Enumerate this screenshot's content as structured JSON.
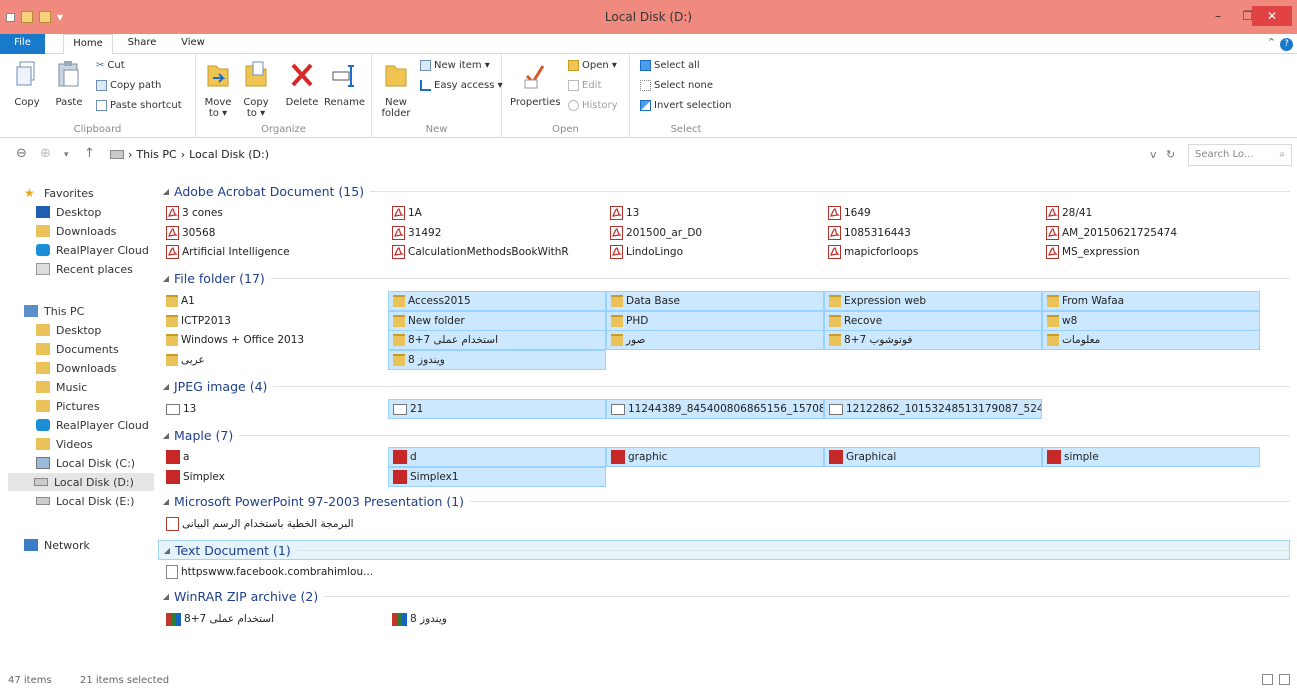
{
  "window": {
    "title": "Local Disk (D:)",
    "minimize": "–",
    "maximize": "❐",
    "close": "✕"
  },
  "tabs": {
    "file": "File",
    "home": "Home",
    "share": "Share",
    "view": "View"
  },
  "ribbon": {
    "clipboard": {
      "label": "Clipboard",
      "copy": "Copy",
      "paste": "Paste",
      "cut": "Cut",
      "copy_path": "Copy path",
      "paste_shortcut": "Paste shortcut"
    },
    "organize": {
      "label": "Organize",
      "move_to": "Move to ▾",
      "copy_to": "Copy to ▾",
      "delete": "Delete",
      "rename": "Rename"
    },
    "new": {
      "label": "New",
      "new_folder": "New folder",
      "new_item": "New item ▾",
      "easy_access": "Easy access ▾"
    },
    "open": {
      "label": "Open",
      "properties": "Properties",
      "open": "Open ▾",
      "edit": "Edit",
      "history": "History"
    },
    "select": {
      "label": "Select",
      "select_all": "Select all",
      "select_none": "Select none",
      "invert_selection": "Invert selection"
    }
  },
  "address": {
    "back": "⊖",
    "forward": "⊕",
    "recent": "▾",
    "up": "↑",
    "crumb_pc": "This PC",
    "sep": "›",
    "crumb_drive": "Local Disk (D:)",
    "dropdown": "v",
    "refresh": "↻",
    "search_placeholder": "Search Lo...",
    "search_glyph": "⌕"
  },
  "navpane": {
    "favorites": "Favorites",
    "desktop": "Desktop",
    "downloads": "Downloads",
    "realplayer": "RealPlayer Cloud",
    "recent": "Recent places",
    "this_pc": "This PC",
    "pc_desktop": "Desktop",
    "documents": "Documents",
    "pc_downloads": "Downloads",
    "music": "Music",
    "pictures": "Pictures",
    "pc_realplayer": "RealPlayer Cloud",
    "videos": "Videos",
    "disk_c": "Local Disk (C:)",
    "disk_d": "Local Disk (D:)",
    "disk_e": "Local Disk (E:)",
    "network": "Network"
  },
  "groups": {
    "adobe": "Adobe Acrobat Document (15)",
    "folder": "File folder (17)",
    "jpeg": "JPEG image (4)",
    "maple": "Maple (7)",
    "ppt": "Microsoft PowerPoint 97-2003 Presentation (1)",
    "txt": "Text Document (1)",
    "rar": "WinRAR ZIP archive (2)",
    "arrow": "◢"
  },
  "pdf_items": [
    "3 cones",
    "1A",
    "13",
    "1649",
    "28/41",
    "30568",
    "31492",
    "201500_ar_D0",
    "1085316443",
    "AM_20150621725474",
    "Artificial Intelligence",
    "CalculationMethodsBookWithR",
    "LindoLingo",
    "mapicforloops",
    "MS_expression"
  ],
  "folder_items": [
    "A1",
    "Access2015",
    "Data Base",
    "Expression web",
    "From Wafaa",
    "ICTP2013",
    "New folder",
    "PHD",
    "Recove",
    "w8",
    "Windows + Office 2013",
    "استخدام عملی 7+8",
    "صور",
    "فوتوشوب 7+8",
    "معلومات",
    "عربی",
    "ویندوز 8"
  ],
  "jpeg_items": [
    "13",
    "21",
    "11244389_845400806865156_15708386...",
    "12122862_10153248513179087_52406..."
  ],
  "maple_items": [
    "a",
    "d",
    "graphic",
    "Graphical",
    "simple",
    "Simplex",
    "Simplex1"
  ],
  "ppt_items": [
    "البرمجة الخطية باستخدام الرسم البیانی"
  ],
  "txt_items": [
    "httpswww.facebook.combrahimlou..."
  ],
  "rar_items": [
    "استخدام عملی 7+8",
    "ویندوز 8"
  ],
  "status": {
    "items": "47 items",
    "selected": "21 items selected"
  }
}
